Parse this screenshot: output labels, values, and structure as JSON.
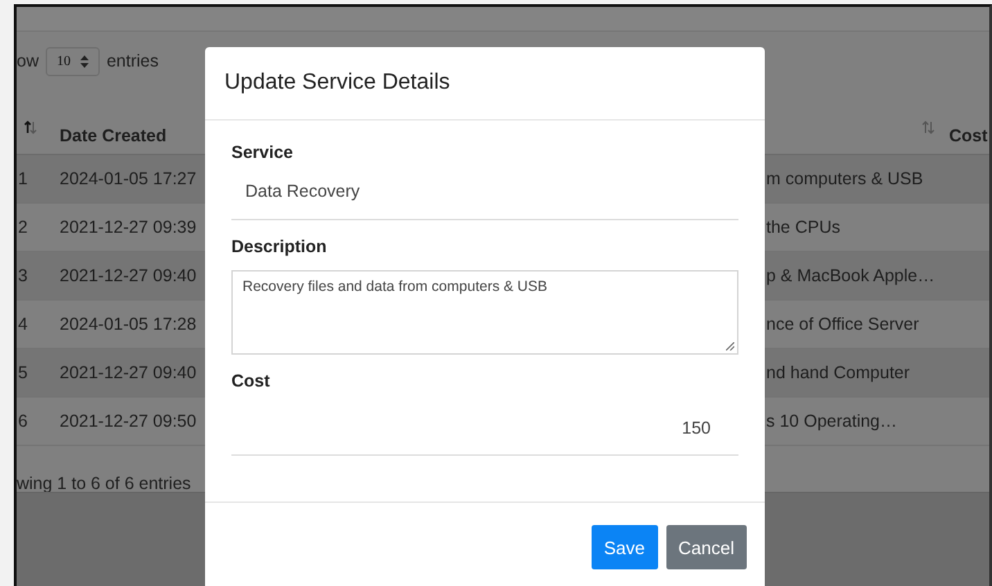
{
  "page": {
    "show_entries": {
      "prefix": "ow",
      "value": "10",
      "suffix": "entries"
    },
    "table": {
      "columns": [
        {
          "label": "Date Created"
        },
        {
          "label": "Cost"
        }
      ],
      "rows": [
        {
          "number": "1",
          "date_created": "2024-01-05 17:27",
          "description": "m computers & USB"
        },
        {
          "number": "2",
          "date_created": "2021-12-27 09:39",
          "description": "the CPUs"
        },
        {
          "number": "3",
          "date_created": "2021-12-27 09:40",
          "description": "p & MacBook Apple…"
        },
        {
          "number": "4",
          "date_created": "2024-01-05 17:28",
          "description": "nce of Office Server"
        },
        {
          "number": "5",
          "date_created": "2021-12-27 09:40",
          "description": "nd hand Computer"
        },
        {
          "number": "6",
          "date_created": "2021-12-27 09:50",
          "description": "s 10 Operating…"
        }
      ],
      "info": "wing 1 to 6 of 6 entries"
    }
  },
  "modal": {
    "title": "Update Service Details",
    "fields": [
      {
        "kind": "input",
        "label": "Service",
        "value": "Data Recovery"
      },
      {
        "kind": "textarea",
        "label": "Description",
        "value": "Recovery files and data from computers & USB"
      },
      {
        "kind": "number",
        "label": "Cost",
        "value": "150"
      }
    ],
    "buttons": [
      {
        "kind": "primary",
        "label": "Save"
      },
      {
        "kind": "secondary",
        "label": "Cancel"
      }
    ]
  }
}
